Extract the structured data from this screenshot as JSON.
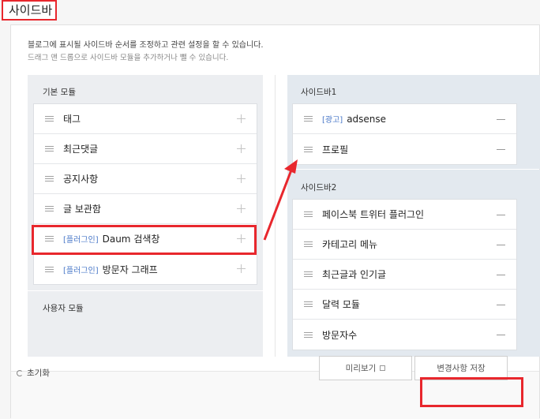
{
  "page": {
    "title": "사이드바"
  },
  "description": {
    "line1": "블로그에 표시될 사이드바 순서를 조정하고 관련 설정을 할 수 있습니다.",
    "line2": "드래그 앤 드롭으로 사이드바 모듈을 추가하거나 뺄 수 있습니다."
  },
  "basic_modules": {
    "title": "기본 모듈",
    "items": [
      {
        "tag": "",
        "label": "태그"
      },
      {
        "tag": "",
        "label": "최근댓글"
      },
      {
        "tag": "",
        "label": "공지사항"
      },
      {
        "tag": "",
        "label": "글 보관함"
      },
      {
        "tag": "[플러그인]",
        "label": "Daum 검색창"
      },
      {
        "tag": "[플러그인]",
        "label": "방문자 그래프"
      }
    ]
  },
  "user_modules": {
    "title": "사용자 모듈"
  },
  "sidebar1": {
    "title": "사이드바1",
    "items": [
      {
        "tag": "[광고]",
        "label": "adsense"
      },
      {
        "tag": "",
        "label": "프로필"
      }
    ]
  },
  "sidebar2": {
    "title": "사이드바2",
    "items": [
      {
        "label": "페이스북 트위터 플러그인"
      },
      {
        "label": "카테고리 메뉴"
      },
      {
        "label": "최근글과 인기글"
      },
      {
        "label": "달력 모듈"
      },
      {
        "label": "방문자수"
      }
    ]
  },
  "footer": {
    "reset_label": "초기화",
    "preview_label": "미리보기",
    "save_label": "변경사항 저장"
  },
  "colors": {
    "highlight": "#e8272d",
    "plugin_tag": "#4a78c8"
  }
}
